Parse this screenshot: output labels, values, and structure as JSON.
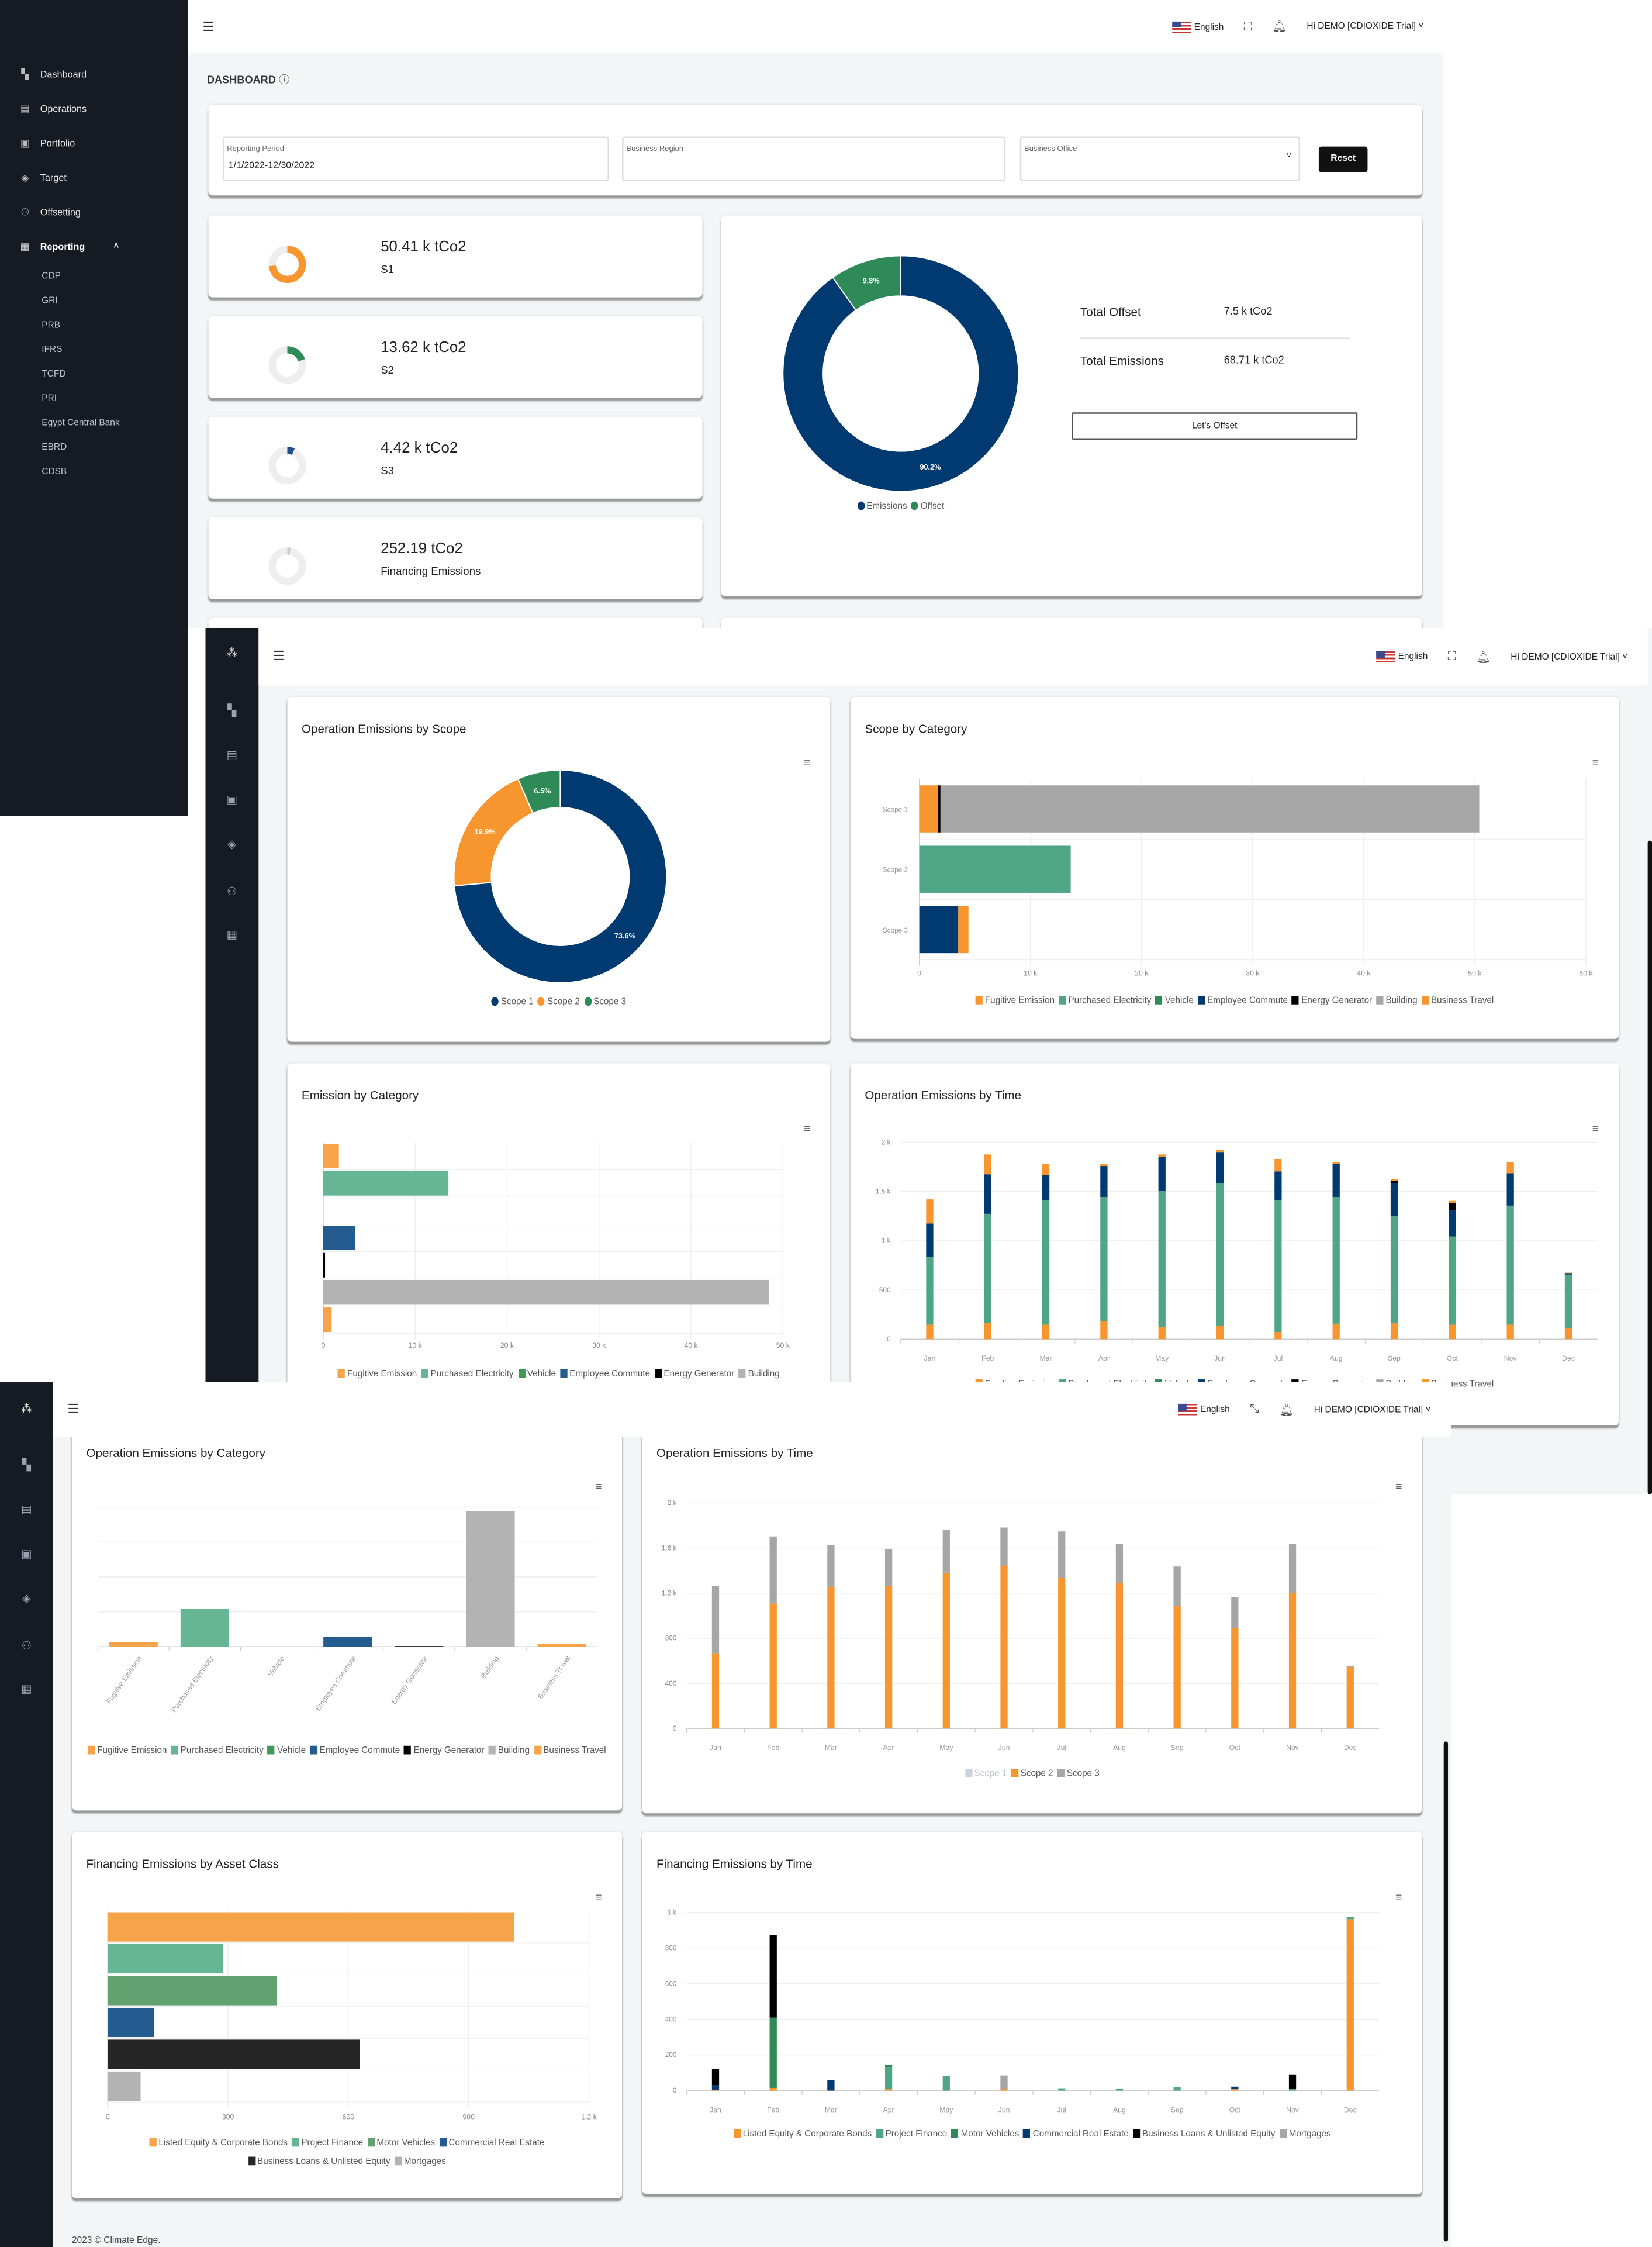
{
  "header": {
    "language": "English",
    "user": "Hi DEMO [CDIOXIDE Trial]",
    "icons": [
      "menu-icon",
      "flag-us-icon",
      "fullscreen-icon",
      "bell-icon",
      "chevron-down-icon"
    ]
  },
  "sidebar": {
    "items": [
      {
        "label": "Dashboard",
        "icon": "dashboard-icon"
      },
      {
        "label": "Operations",
        "icon": "operations-icon"
      },
      {
        "label": "Portfolio",
        "icon": "briefcase-icon"
      },
      {
        "label": "Target",
        "icon": "target-icon"
      },
      {
        "label": "Offsetting",
        "icon": "people-icon"
      },
      {
        "label": "Reporting",
        "icon": "report-icon"
      }
    ],
    "reporting_sub": [
      "CDP",
      "GRI",
      "PRB",
      "IFRS",
      "TCFD",
      "PRI",
      "Egypt Central Bank",
      "EBRD",
      "CDSB"
    ]
  },
  "dashboard": {
    "title": "DASHBOARD",
    "filters": {
      "period_label": "Reporting Period",
      "period_value": "1/1/2022-12/30/2022",
      "region_label": "Business Region",
      "office_label": "Business Office",
      "reset": "Reset"
    },
    "kpis": [
      {
        "value": "50.41 k tCo2",
        "label": "S1",
        "share": 73.6,
        "color": "#f7962f"
      },
      {
        "value": "13.62 k tCo2",
        "label": "S2",
        "share": 19.9,
        "color": "#2e8b57"
      },
      {
        "value": "4.42 k tCo2",
        "label": "S3",
        "share": 6.5,
        "color": "#1f4e8c"
      },
      {
        "value": "252.19 tCo2",
        "label": "Financing Emissions",
        "share": 0.4,
        "color": "#cccccc"
      }
    ],
    "offset": {
      "total_offset_label": "Total Offset",
      "total_offset_value": "7.5 k tCo2",
      "total_emissions_label": "Total Emissions",
      "total_emissions_value": "68.71 k tCo2",
      "button": "Let's Offset"
    }
  },
  "footer": "2023 © Climate Edge.",
  "chart_data": [
    {
      "type": "pie",
      "title": "",
      "series": [
        {
          "name": "Emissions",
          "value": 90.2,
          "label": "90.2%",
          "color": "#003a70"
        },
        {
          "name": "Offset",
          "value": 9.8,
          "label": "9.8%",
          "color": "#2e8b57"
        }
      ],
      "legend": "bottom"
    },
    {
      "type": "pie",
      "title": "Operation Emissions by Scope",
      "series": [
        {
          "name": "Scope 1",
          "value": 73.6,
          "label": "73.6%",
          "color": "#003a70"
        },
        {
          "name": "Scope 2",
          "value": 19.9,
          "label": "19.9%",
          "color": "#f7962f"
        },
        {
          "name": "Scope 3",
          "value": 6.5,
          "label": "6.5%",
          "color": "#2e8b57"
        }
      ],
      "legend": "bottom"
    },
    {
      "type": "bar",
      "orientation": "horizontal",
      "stacked": true,
      "title": "Scope by Category",
      "categories": [
        "Scope 1",
        "Scope 2",
        "Scope 3"
      ],
      "series": [
        {
          "name": "Fugitive Emission",
          "color": "#f7962f",
          "values": [
            1700,
            0,
            0
          ]
        },
        {
          "name": "Purchased Electricity",
          "color": "#4fa687",
          "values": [
            0,
            13620,
            0
          ]
        },
        {
          "name": "Vehicle",
          "color": "#2e8b57",
          "values": [
            0,
            0,
            0
          ]
        },
        {
          "name": "Employee Commute",
          "color": "#003a70",
          "values": [
            0,
            0,
            3500
          ]
        },
        {
          "name": "Energy Generator",
          "color": "#000000",
          "values": [
            200,
            0,
            0
          ]
        },
        {
          "name": "Building",
          "color": "#a6a6a6",
          "values": [
            48500,
            0,
            0
          ]
        },
        {
          "name": "Business Travel",
          "color": "#f7962f",
          "values": [
            0,
            0,
            920
          ]
        }
      ],
      "axis": {
        "min": 0,
        "max": 60000,
        "tick_labels": [
          "0",
          "10 k",
          "20 k",
          "30 k",
          "40 k",
          "50 k",
          "60 k"
        ]
      },
      "grid": true,
      "legend": "bottom"
    },
    {
      "type": "bar",
      "orientation": "horizontal",
      "title": "Emission by Category",
      "categories": [
        "Fugitive Emission",
        "Purchased Electricity",
        "Vehicle",
        "Employee Commute",
        "Energy Generator",
        "Building",
        "Business Travel"
      ],
      "values": [
        1700,
        13620,
        0,
        3500,
        200,
        48500,
        920
      ],
      "colors": [
        "#f7a34a",
        "#66b595",
        "#3f9a5a",
        "#255c90",
        "#000000",
        "#b3b3b3",
        "#f7a34a"
      ],
      "axis": {
        "min": 0,
        "max": 50000,
        "tick_labels": [
          "0",
          "10 k",
          "20 k",
          "30 k",
          "40 k",
          "50 k"
        ]
      },
      "grid": true,
      "legend": "bottom"
    },
    {
      "type": "bar",
      "orientation": "vertical",
      "stacked": true,
      "title": "Operation Emissions by Time",
      "categories": [
        "Jan",
        "Feb",
        "Mar",
        "Apr",
        "May",
        "Jun",
        "Jul",
        "Aug",
        "Sep",
        "Oct",
        "Nov",
        "Dec"
      ],
      "series": [
        {
          "name": "Fugitive Emission",
          "color": "#f7962f",
          "values": [
            147,
            162,
            147,
            181,
            122,
            137,
            73,
            157,
            162,
            147,
            147,
            113
          ]
        },
        {
          "name": "Purchased Electricity",
          "color": "#4fa687",
          "values": [
            686,
            1112,
            1264,
            1260,
            1382,
            1451,
            1338,
            1284,
            1088,
            897,
            1210,
            548
          ]
        },
        {
          "name": "Vehicle",
          "color": "#2e8b57",
          "values": [
            0,
            0,
            0,
            0,
            0,
            0,
            0,
            0,
            0,
            0,
            0,
            0
          ]
        },
        {
          "name": "Employee Commute",
          "color": "#003a70",
          "values": [
            343,
            402,
            260,
            313,
            348,
            308,
            294,
            338,
            338,
            264,
            324,
            5
          ]
        },
        {
          "name": "Energy Generator",
          "color": "#000000",
          "values": [
            0,
            0,
            0,
            0,
            0,
            0,
            0,
            0,
            24,
            74,
            0,
            0
          ]
        },
        {
          "name": "Building",
          "color": "#a6a6a6",
          "values": [
            0,
            0,
            0,
            0,
            0,
            0,
            0,
            0,
            0,
            0,
            0,
            0
          ]
        },
        {
          "name": "Business Travel",
          "color": "#f7962f",
          "values": [
            245,
            201,
            108,
            25,
            25,
            25,
            123,
            19,
            15,
            24,
            117,
            10
          ]
        }
      ],
      "axis": {
        "min": 0,
        "max": 2000,
        "tick_labels": [
          "0",
          "500",
          "1 k",
          "1.5 k",
          "2 k"
        ]
      },
      "grid": true,
      "legend": "bottom"
    },
    {
      "type": "bar",
      "orientation": "vertical",
      "title": "Operation Emissions by Category",
      "categories": [
        "Fugitive Emission",
        "Purchased Electricity",
        "Vehicle",
        "Employee Commute",
        "Energy Generator",
        "Building",
        "Business Travel"
      ],
      "values": [
        1700,
        13620,
        0,
        3500,
        200,
        48500,
        920
      ],
      "colors": [
        "#f7a34a",
        "#66b595",
        "#3f9a5a",
        "#255c90",
        "#000000",
        "#b3b3b3",
        "#f7a34a"
      ],
      "axis": {
        "min": 0,
        "max": 50000,
        "tick_labels": []
      },
      "grid": true,
      "legend": "bottom"
    },
    {
      "type": "bar",
      "orientation": "vertical",
      "stacked": true,
      "title": "Operation Emissions by Time",
      "categories": [
        "Jan",
        "Feb",
        "Mar",
        "Apr",
        "May",
        "Jun",
        "Jul",
        "Aug",
        "Sep",
        "Oct",
        "Nov",
        "Dec"
      ],
      "series": [
        {
          "name": "Scope 1",
          "color": "#c9d3de",
          "hidden": true
        },
        {
          "name": "Scope 2",
          "color": "#f7962f",
          "values": [
            668,
            1109,
            1252,
            1262,
            1381,
            1445,
            1337,
            1287,
            1084,
            891,
            1203,
            545
          ]
        },
        {
          "name": "Scope 3",
          "color": "#a6a6a6",
          "values": [
            594,
            594,
            377,
            327,
            381,
            337,
            410,
            352,
            352,
            277,
            436,
            9
          ]
        }
      ],
      "axis": {
        "min": 0,
        "max": 2000,
        "tick_labels": [
          "0",
          "400",
          "800",
          "1.2 k",
          "1.6 k",
          "2 k"
        ]
      },
      "grid": true,
      "legend": "bottom"
    },
    {
      "type": "bar",
      "orientation": "horizontal",
      "title": "Financing Emissions by Asset Class",
      "categories": [
        "Listed Equity & Corporate Bonds",
        "Project Finance",
        "Motor Vehicles",
        "Commercial Real Estate",
        "Business Loans & Unlisted Equity",
        "Mortgages"
      ],
      "values": [
        1013,
        287,
        421,
        116,
        629,
        82
      ],
      "colors": [
        "#f7a34a",
        "#66b595",
        "#62a170",
        "#255c90",
        "#262626",
        "#b3b3b3"
      ],
      "axis": {
        "min": 0,
        "max": 1200,
        "tick_labels": [
          "0",
          "300",
          "600",
          "900",
          "1.2 k"
        ]
      },
      "grid": true,
      "legend": "bottom"
    },
    {
      "type": "bar",
      "orientation": "vertical",
      "stacked": true,
      "title": "Financing Emissions by Time",
      "categories": [
        "Jan",
        "Feb",
        "Mar",
        "Apr",
        "May",
        "Jun",
        "Jul",
        "Aug",
        "Sep",
        "Oct",
        "Nov",
        "Dec"
      ],
      "series": [
        {
          "name": "Listed Equity & Corporate Bonds",
          "color": "#f7962f",
          "values": [
            5,
            15,
            0,
            10,
            0,
            10,
            0,
            0,
            0,
            8,
            0,
            962
          ]
        },
        {
          "name": "Project Finance",
          "color": "#4fa687",
          "values": [
            0,
            0,
            0,
            120,
            82,
            0,
            13,
            12,
            18,
            0,
            10,
            13
          ]
        },
        {
          "name": "Motor Vehicles",
          "color": "#2e8b57",
          "values": [
            0,
            395,
            0,
            16,
            0,
            0,
            0,
            0,
            0,
            0,
            0,
            0
          ]
        },
        {
          "name": "Commercial Real Estate",
          "color": "#003a70",
          "values": [
            25,
            0,
            60,
            0,
            0,
            0,
            0,
            0,
            0,
            14,
            0,
            0
          ]
        },
        {
          "name": "Business Loans & Unlisted Equity",
          "color": "#000000",
          "values": [
            90,
            464,
            0,
            0,
            0,
            0,
            0,
            0,
            0,
            0,
            81,
            0
          ]
        },
        {
          "name": "Mortgages",
          "color": "#a6a6a6",
          "values": [
            0,
            0,
            0,
            0,
            0,
            75,
            0,
            0,
            0,
            0,
            0,
            0
          ]
        }
      ],
      "axis": {
        "min": 0,
        "max": 1000,
        "tick_labels": [
          "0",
          "200",
          "400",
          "600",
          "800",
          "1 k"
        ]
      },
      "grid": true,
      "legend": "bottom"
    }
  ]
}
